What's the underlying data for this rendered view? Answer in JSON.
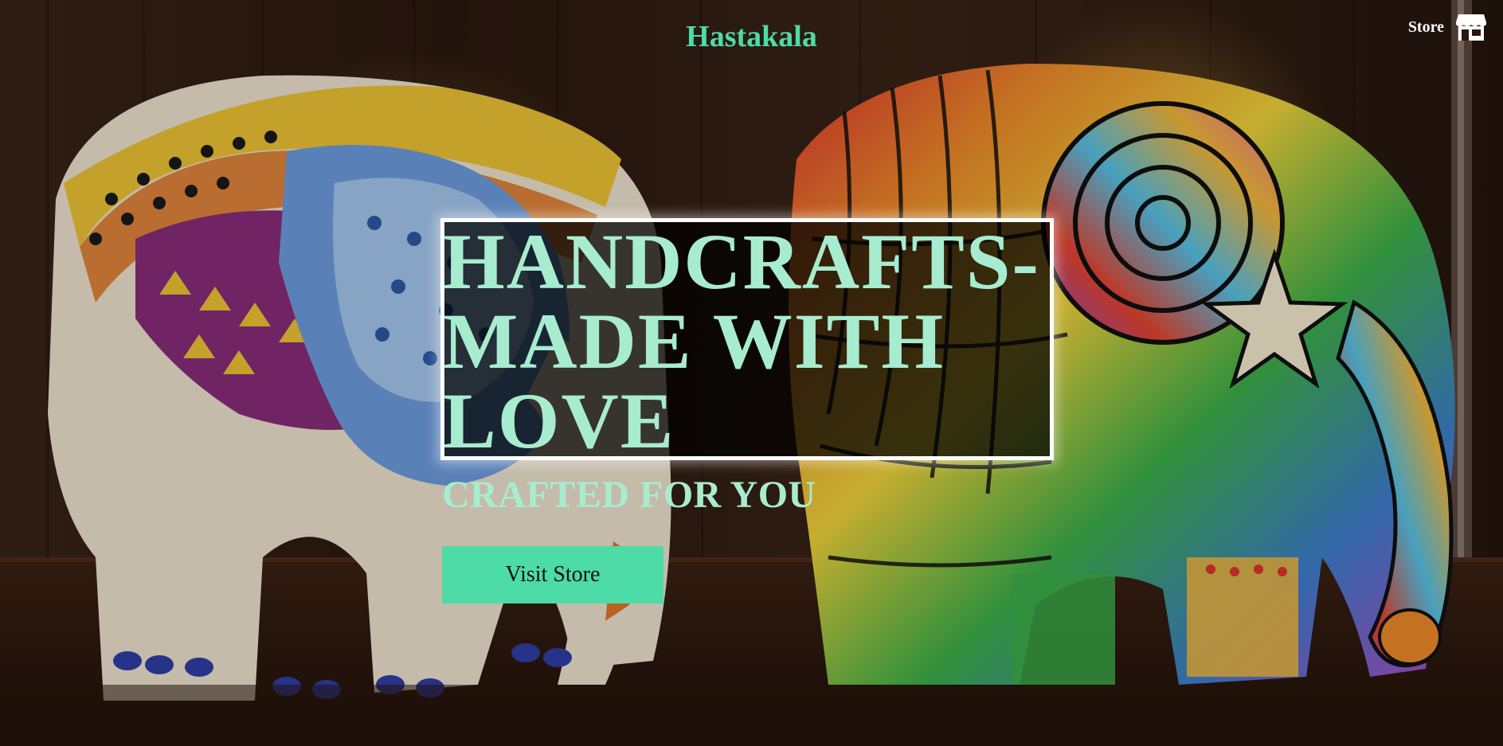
{
  "header": {
    "brand": "Hastakala",
    "store_link_label": "Store",
    "store_icon": "storefront-icon"
  },
  "hero": {
    "heading": "HANDCRAFTS-\nMADE WITH\nLOVE",
    "subheading": "CRAFTED FOR YOU",
    "cta_label": "Visit Store",
    "background": "elephant-figurines-photo"
  },
  "colors": {
    "accent": "#4ddba8",
    "heading_text": "#a8ecd0",
    "white": "#ffffff",
    "button_text": "#111111"
  }
}
